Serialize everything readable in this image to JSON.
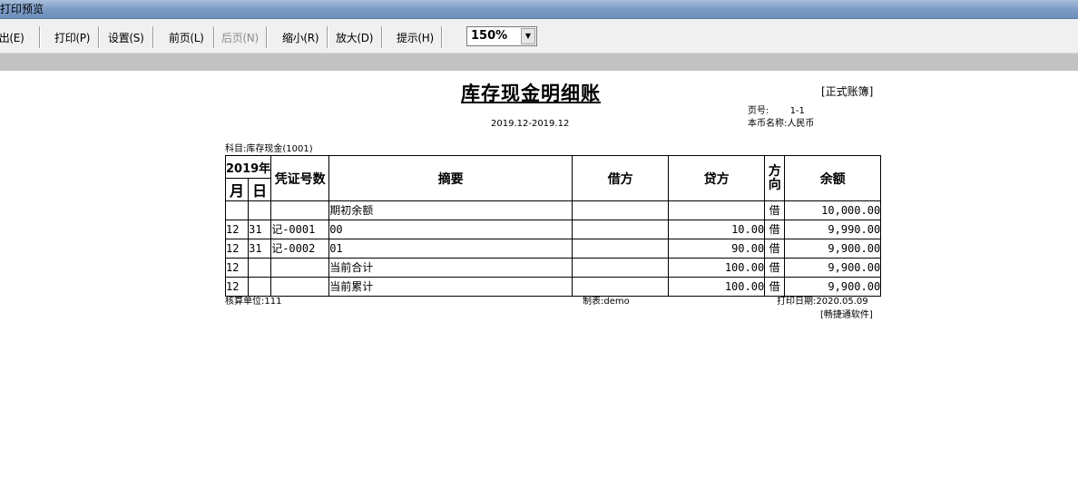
{
  "window": {
    "title": "打印预览"
  },
  "toolbar": {
    "exit": "退出(E)",
    "print": "打印(P)",
    "settings": "设置(S)",
    "prev": "前页(L)",
    "next": "后页(N)",
    "zoom_out": "缩小(R)",
    "zoom_in": "放大(D)",
    "tips": "提示(H)",
    "zoom_value": "150%"
  },
  "report": {
    "title": "库存现金明细账",
    "type_tag": "[正式账簿]",
    "period": "2019.12-2019.12",
    "page_label": "页号:",
    "page_value": "1-1",
    "currency_label": "本币名称:",
    "currency_value": "人民币",
    "subject_label": "科目:",
    "subject_value": "库存现金(1001)",
    "headers": {
      "year": "2019年",
      "month": "月",
      "day": "日",
      "voucher": "凭证号数",
      "summary": "摘要",
      "debit": "借方",
      "credit": "贷方",
      "direction": "方向",
      "balance": "余额"
    },
    "rows": [
      {
        "month": "",
        "day": "",
        "voucher": "",
        "summary": "期初余额",
        "debit": "",
        "credit": "",
        "direction": "借",
        "balance": "10,000.00"
      },
      {
        "month": "12",
        "day": "31",
        "voucher": "记-0001",
        "summary": "00",
        "debit": "",
        "credit": "10.00",
        "direction": "借",
        "balance": "9,990.00"
      },
      {
        "month": "12",
        "day": "31",
        "voucher": "记-0002",
        "summary": "01",
        "debit": "",
        "credit": "90.00",
        "direction": "借",
        "balance": "9,900.00"
      },
      {
        "month": "12",
        "day": "",
        "voucher": "",
        "summary": "当前合计",
        "debit": "",
        "credit": "100.00",
        "direction": "借",
        "balance": "9,900.00"
      },
      {
        "month": "12",
        "day": "",
        "voucher": "",
        "summary": "当前累计",
        "debit": "",
        "credit": "100.00",
        "direction": "借",
        "balance": "9,900.00"
      }
    ],
    "footer": {
      "unit_label": "核算单位:",
      "unit_value": "111",
      "maker_label": "制表:",
      "maker_value": "demo",
      "date_label": "打印日期:",
      "date_value": "2020.05.09",
      "software": "[畅捷通软件]"
    }
  }
}
